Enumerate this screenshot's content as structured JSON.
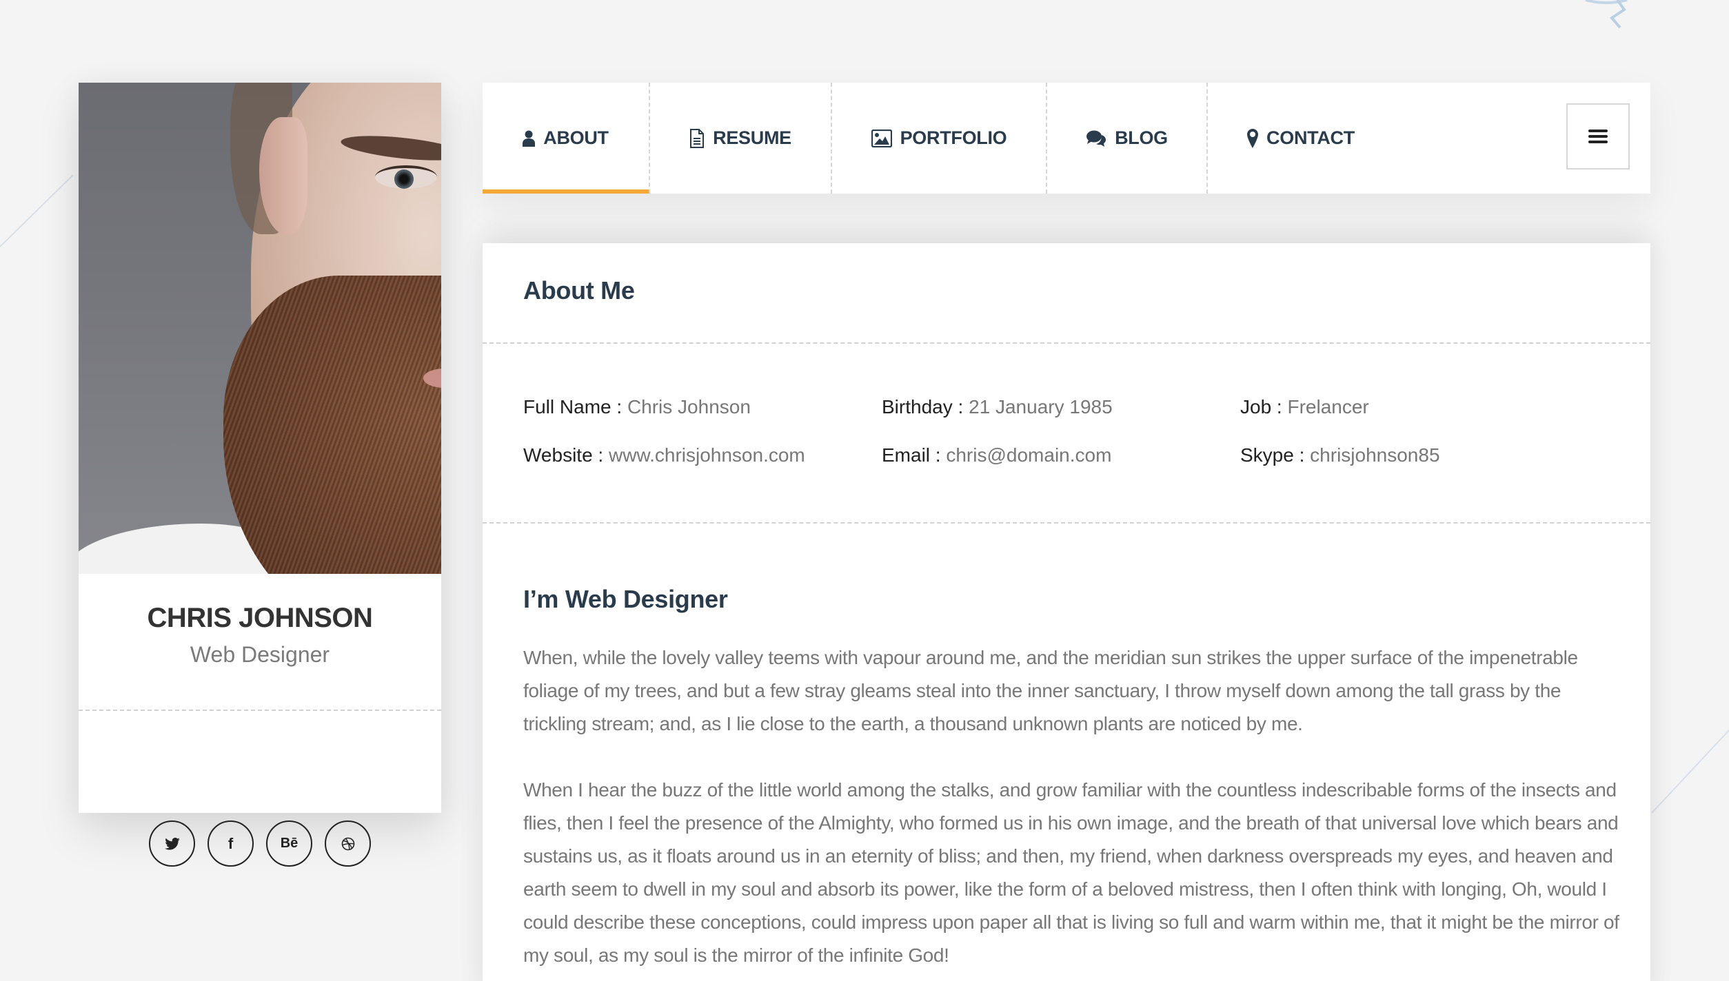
{
  "profile": {
    "name": "CHRIS JOHNSON",
    "title": "Web Designer",
    "photo_alt": "Portrait of a bearded man",
    "socials": [
      {
        "name": "twitter",
        "icon": "twitter-icon"
      },
      {
        "name": "facebook",
        "icon": "facebook-icon",
        "glyph": "f"
      },
      {
        "name": "behance",
        "icon": "behance-icon",
        "glyph": "Bē"
      },
      {
        "name": "dribbble",
        "icon": "dribbble-icon"
      }
    ]
  },
  "nav": {
    "items": [
      {
        "label": "ABOUT",
        "icon": "user-icon",
        "active": true
      },
      {
        "label": "RESUME",
        "icon": "document-icon",
        "active": false
      },
      {
        "label": "PORTFOLIO",
        "icon": "image-icon",
        "active": false
      },
      {
        "label": "BLOG",
        "icon": "comments-icon",
        "active": false
      },
      {
        "label": "CONTACT",
        "icon": "map-marker-icon",
        "active": false
      }
    ],
    "menu_icon": "hamburger-icon",
    "accent_color": "#f6a839"
  },
  "about": {
    "title": "About Me",
    "info": [
      {
        "label": "Full Name :",
        "value": "Chris Johnson"
      },
      {
        "label": "Birthday :",
        "value": "21 January 1985"
      },
      {
        "label": "Job :",
        "value": "Frelancer"
      },
      {
        "label": "Website :",
        "value": "www.chrisjohnson.com"
      },
      {
        "label": "Email :",
        "value": "chris@domain.com"
      },
      {
        "label": "Skype :",
        "value": "chrisjohnson85"
      }
    ],
    "subtitle": "I’m Web Designer",
    "paragraphs": [
      "When, while the lovely valley teems with vapour around me, and the meridian sun strikes the upper surface of the impenetrable foliage of my trees, and but a few stray gleams steal into the inner sanctuary, I throw myself down among the tall grass by the trickling stream; and, as I lie close to the earth, a thousand unknown plants are noticed by me.",
      "When I hear the buzz of the little world among the stalks, and grow familiar with the countless indescribable forms of the insects and flies, then I feel the presence of the Almighty, who formed us in his own image, and the breath of that universal love which bears and sustains us, as it floats around us in an eternity of bliss; and then, my friend, when darkness overspreads my eyes, and heaven and earth seem to dwell in my soul and absorb its power, like the form of a beloved mistress, then I often think with longing, Oh, would I could describe these conceptions, could impress upon paper all that is living so full and warm within me, that it might be the mirror of my soul, as my soul is the mirror of the infinite God!"
    ]
  }
}
